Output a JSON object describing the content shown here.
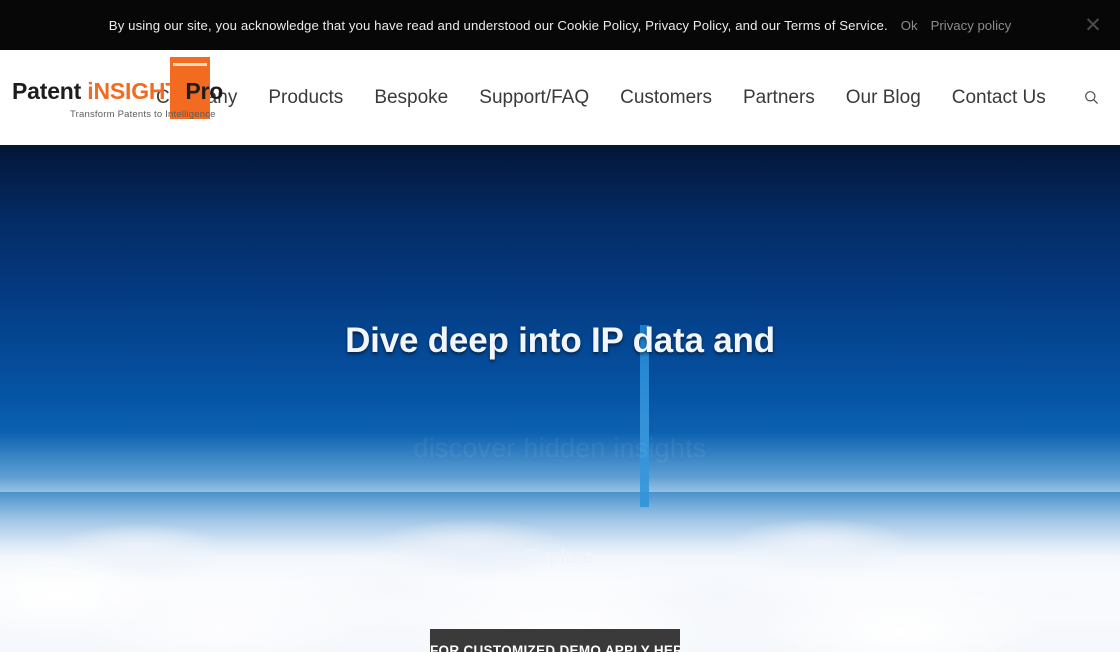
{
  "cookie_bar": {
    "message": "By using our site, you acknowledge that you have read and understood our Cookie Policy, Privacy Policy, and our Terms of Service.",
    "ok_label": "Ok",
    "privacy_policy_label": "Privacy policy",
    "close_icon": "close-icon",
    "close_glyph": "✕",
    "background": "#070707",
    "text_color": "#eceaea",
    "link_color": "#8e8c8c"
  },
  "header": {
    "logo": {
      "word1": "Patent",
      "word2": "iNSIGHT",
      "word3": "Pro",
      "tagline": "Transform Patents to Intelligence",
      "accent_color": "#f26b21",
      "text_color": "#1d1d1b"
    },
    "nav_items": [
      {
        "label": "Company"
      },
      {
        "label": "Products"
      },
      {
        "label": "Bespoke"
      },
      {
        "label": "Support/FAQ"
      },
      {
        "label": "Customers"
      },
      {
        "label": "Partners"
      },
      {
        "label": "Our Blog"
      },
      {
        "label": "Contact Us"
      }
    ],
    "search_icon": "search-icon",
    "background": "#ffffff",
    "nav_text_color": "#3a3a3a"
  },
  "hero": {
    "headline": "Dive deep into IP data and",
    "subline": "discover hidden insights",
    "explore_label": "Explore",
    "accent_bar_color": "#2f92da",
    "sky_top_color": "#031537",
    "sky_bottom_color": "#8fb9dd"
  },
  "cta": {
    "label": "FOR CUSTOMIZED DEMO APPLY HERE",
    "background": "#3a3a3a",
    "text_color": "#ffffff"
  }
}
